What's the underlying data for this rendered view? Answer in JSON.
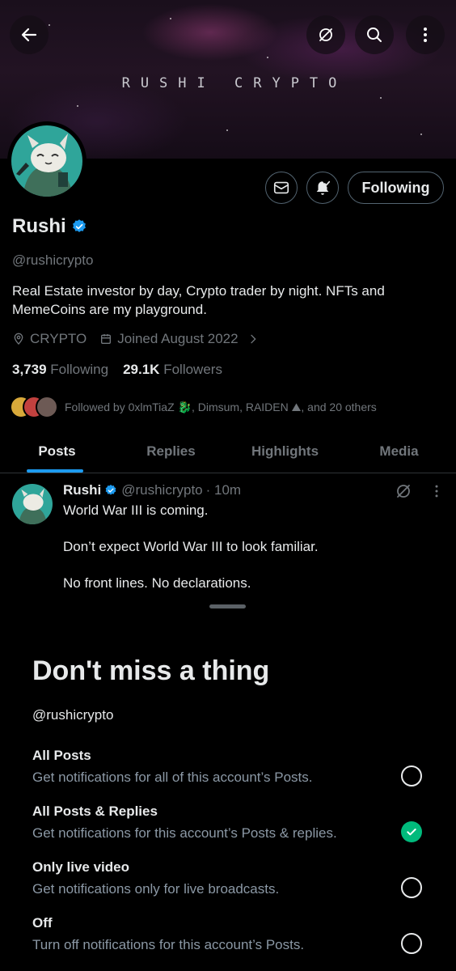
{
  "banner": {
    "title": "RUSHI CRYPTO"
  },
  "icons": {
    "back": "arrow-left-icon",
    "grok": "grok-icon",
    "search": "search-icon",
    "more": "more-vertical-icon",
    "message": "envelope-icon",
    "bell": "bell-check-icon"
  },
  "profile": {
    "name": "Rushi",
    "handle": "@rushicrypto",
    "bio": "Real Estate investor by day, Crypto trader by night. NFTs and MemeCoins are my playground.",
    "location": "CRYPTO",
    "joined": "Joined August 2022",
    "following_count": "3,739",
    "following_label": "Following",
    "followers_count": "29.1K",
    "followers_label": "Followers",
    "followed_by": "Followed by 0xlmTiaZ 🐉, Dimsum, RAIDEN ⛰, and 20 others",
    "follow_button": "Following"
  },
  "tabs": [
    {
      "label": "Posts",
      "active": true
    },
    {
      "label": "Replies",
      "active": false
    },
    {
      "label": "Highlights",
      "active": false
    },
    {
      "label": "Media",
      "active": false
    }
  ],
  "post": {
    "name": "Rushi",
    "handle": "@rushicrypto",
    "time": "· 10m",
    "line1": "World War III is coming.",
    "line2": "Don’t expect World War III to look familiar.",
    "line3": "No front lines. No declarations."
  },
  "sheet": {
    "title": "Don't miss a thing",
    "handle": "@rushicrypto",
    "options": [
      {
        "title": "All Posts",
        "desc": "Get notifications for all of this account’s Posts.",
        "selected": false
      },
      {
        "title": "All Posts & Replies",
        "desc": "Get notifications for this account’s Posts & replies.",
        "selected": true
      },
      {
        "title": "Only live video",
        "desc": "Get notifications only for live broadcasts.",
        "selected": false
      },
      {
        "title": "Off",
        "desc": "Turn off notifications for this account’s Posts.",
        "selected": false
      }
    ]
  },
  "colors": {
    "accent": "#1d9bf0",
    "check": "#00ba7c",
    "muted": "#71767b"
  }
}
